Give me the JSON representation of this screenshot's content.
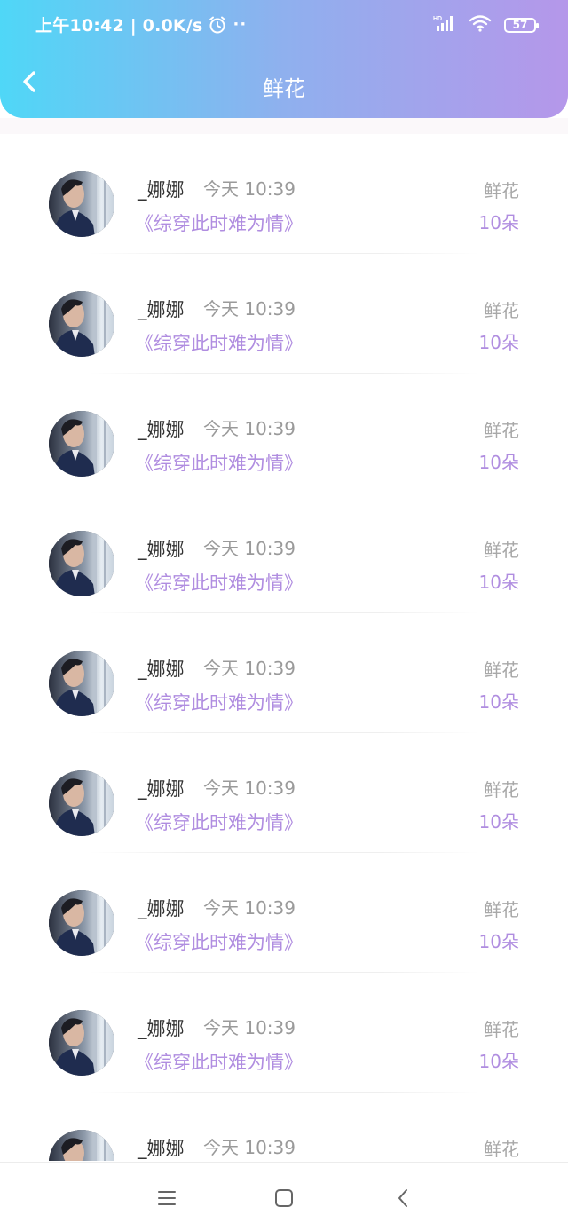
{
  "status_bar": {
    "time_speed": "上午10:42 | 0.0K/s",
    "dots": "··",
    "network_label": "HD",
    "battery_level": "57"
  },
  "header": {
    "title": "鲜花"
  },
  "list": {
    "items": [
      {
        "name": "_娜娜",
        "time": "今天 10:39",
        "book": "《综穿此时难为情》",
        "gift_label": "鲜花",
        "gift_count": "10朵"
      },
      {
        "name": "_娜娜",
        "time": "今天 10:39",
        "book": "《综穿此时难为情》",
        "gift_label": "鲜花",
        "gift_count": "10朵"
      },
      {
        "name": "_娜娜",
        "time": "今天 10:39",
        "book": "《综穿此时难为情》",
        "gift_label": "鲜花",
        "gift_count": "10朵"
      },
      {
        "name": "_娜娜",
        "time": "今天 10:39",
        "book": "《综穿此时难为情》",
        "gift_label": "鲜花",
        "gift_count": "10朵"
      },
      {
        "name": "_娜娜",
        "time": "今天 10:39",
        "book": "《综穿此时难为情》",
        "gift_label": "鲜花",
        "gift_count": "10朵"
      },
      {
        "name": "_娜娜",
        "time": "今天 10:39",
        "book": "《综穿此时难为情》",
        "gift_label": "鲜花",
        "gift_count": "10朵"
      },
      {
        "name": "_娜娜",
        "time": "今天 10:39",
        "book": "《综穿此时难为情》",
        "gift_label": "鲜花",
        "gift_count": "10朵"
      },
      {
        "name": "_娜娜",
        "time": "今天 10:39",
        "book": "《综穿此时难为情》",
        "gift_label": "鲜花",
        "gift_count": "10朵"
      },
      {
        "name": "_娜娜",
        "time": "今天 10:39",
        "book": "",
        "gift_label": "鲜花",
        "gift_count": ""
      }
    ]
  },
  "colors": {
    "header_gradient_start": "#4fd7f7",
    "header_gradient_end": "#b597ea",
    "accent_purple": "#b08de0"
  },
  "icons": {
    "back": "chevron-left-icon",
    "alarm": "alarm-clock-icon",
    "signal": "signal-icon",
    "wifi": "wifi-icon",
    "battery": "battery-icon",
    "menu": "menu-icon",
    "home": "home-square-icon",
    "nav_back": "nav-back-icon"
  }
}
